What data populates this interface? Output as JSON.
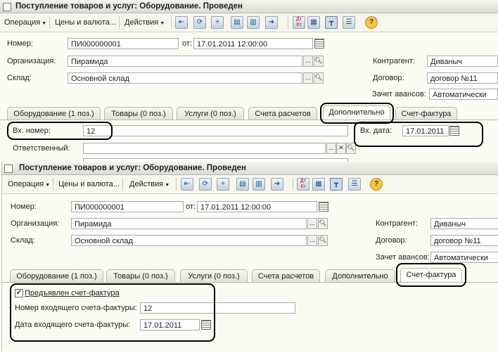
{
  "window1": {
    "title": "Поступление товаров и услуг: Оборудование. Проведен",
    "toolbar": {
      "operation": "Операция",
      "prices": "Цены и валюта...",
      "actions": "Действия",
      "dt_kt": "Дт Кт"
    },
    "labels": {
      "number": "Номер:",
      "from": "от:",
      "org": "Организация:",
      "warehouse": "Склад:",
      "contractor": "Контрагент:",
      "contract": "Договор:",
      "advance": "Зачет авансов:"
    },
    "values": {
      "number": "ПИ000000001",
      "date": "17.01.2011 12:00:00",
      "org": "Пирамида",
      "warehouse": "Основной склад",
      "contractor": "Диваныч",
      "contract": "договор №11",
      "advance": "Автоматически"
    },
    "tabs": [
      "Оборудование (1 поз.)",
      "Товары (0 поз.)",
      "Услуги (0 поз.)",
      "Счета расчетов",
      "Дополнительно",
      "Счет-фактура"
    ],
    "active_tab": "Дополнительно",
    "extra": {
      "in_number_label": "Вх. номер:",
      "in_number": "12",
      "in_date_label": "Вх. дата:",
      "in_date": "17.01.2011",
      "responsible_label": "Ответственный:"
    }
  },
  "window2": {
    "title": "Поступление товаров и услуг: Оборудование. Проведен",
    "toolbar": {
      "operation": "Операция",
      "prices": "Цены и валюта...",
      "actions": "Действия",
      "dt_kt": "Дт Кт"
    },
    "labels": {
      "number": "Номер:",
      "from": "от:",
      "org": "Организация:",
      "warehouse": "Склад:",
      "contractor": "Контрагент:",
      "contract": "Договор:",
      "advance": "Зачет авансов:"
    },
    "values": {
      "number": "ПИ000000001",
      "date": "17.01.2011 12:00:00",
      "org": "Пирамида",
      "warehouse": "Основной склад",
      "contractor": "Диваныч",
      "contract": "договор №11",
      "advance": "Автоматически"
    },
    "tabs": [
      "Оборудование (1 поз.)",
      "Товары (0 поз.)",
      "Услуги (0 поз.)",
      "Счета расчетов",
      "Дополнительно",
      "Счет-фактура"
    ],
    "active_tab": "Счет-фактура",
    "invoice": {
      "presented_label": "Предъявлен счет-фактура",
      "presented": true,
      "in_number_label": "Номер входящего счета-фактуры:",
      "in_number": "12",
      "in_date_label": "Дата входящего счета-фактуры:",
      "in_date": "17.01.2011"
    }
  },
  "icons": [
    "app-icon",
    "open-list-icon",
    "refresh-icon",
    "copy-icon",
    "post-icon",
    "unpost-icon",
    "goto-icon",
    "dtkt-icon",
    "print-icon",
    "structure-icon",
    "list-icon",
    "help-icon",
    "calendar-icon",
    "search-icon"
  ]
}
